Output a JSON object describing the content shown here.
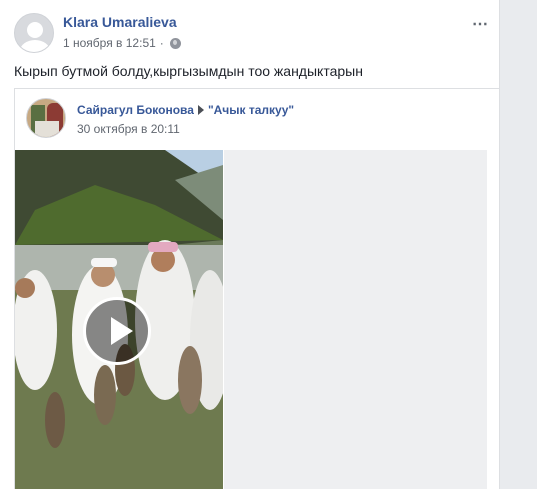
{
  "post": {
    "author": "Klara Umaralieva",
    "timestamp": "1 ноября в 12:51",
    "text": "Кырып бутмой болду,кыргызымдын тоо жандыктарын",
    "more_icon": "⋯"
  },
  "shared": {
    "author": "Сайрагул Боконова",
    "group": "\"Ачык талкуу\"",
    "timestamp": "30 октября в 20:11"
  },
  "colors": {
    "link": "#385898",
    "meta": "#616770",
    "background": "#e9ebee"
  }
}
